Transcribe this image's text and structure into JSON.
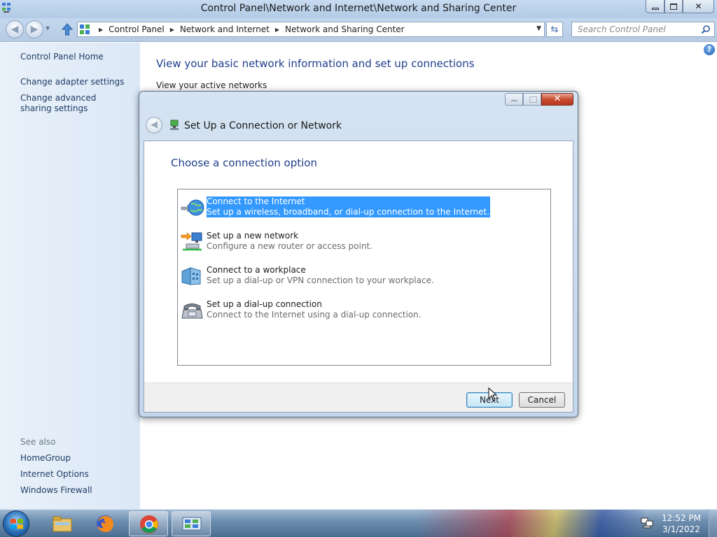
{
  "window": {
    "title": "Control Panel\\Network and Internet\\Network and Sharing Center"
  },
  "address": {
    "crumbs": [
      "Control Panel",
      "Network and Internet",
      "Network and Sharing Center"
    ],
    "search_placeholder": "Search Control Panel"
  },
  "sidebar": {
    "home": "Control Panel Home",
    "links": [
      "Change adapter settings",
      "Change advanced sharing settings"
    ],
    "see_also_label": "See also",
    "see_also": [
      "HomeGroup",
      "Internet Options",
      "Windows Firewall"
    ]
  },
  "main": {
    "heading": "View your basic network information and set up connections",
    "subheading": "View your active networks"
  },
  "dialog": {
    "title": "Set Up a Connection or Network",
    "heading": "Choose a connection option",
    "options": [
      {
        "title": "Connect to the Internet",
        "desc": "Set up a wireless, broadband, or dial-up connection to the Internet.",
        "icon": "globe-icon",
        "selected": true
      },
      {
        "title": "Set up a new network",
        "desc": "Configure a new router or access point.",
        "icon": "network-setup-icon",
        "selected": false
      },
      {
        "title": "Connect to a workplace",
        "desc": "Set up a dial-up or VPN connection to your workplace.",
        "icon": "workplace-icon",
        "selected": false
      },
      {
        "title": "Set up a dial-up connection",
        "desc": "Connect to the Internet using a dial-up connection.",
        "icon": "phone-modem-icon",
        "selected": false
      }
    ],
    "next_label": "Next",
    "cancel_label": "Cancel"
  },
  "taskbar": {
    "apps": [
      "file-explorer-icon",
      "firefox-icon",
      "chrome-icon",
      "control-panel-icon"
    ],
    "time": "12:52 PM",
    "date": "3/1/2022"
  },
  "colors": {
    "heading_blue": "#1f3e8a",
    "selection": "#3399ff",
    "link": "#1e3c64"
  }
}
